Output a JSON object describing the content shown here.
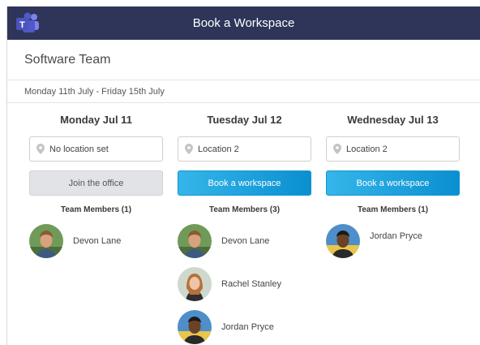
{
  "app": {
    "window_title": "Book a Workspace",
    "logo_icon": "teams-icon"
  },
  "team": {
    "name": "Software Team"
  },
  "date_range": "Monday 11th July - Friday 15th July",
  "colors": {
    "titlebar": "#2e3559",
    "button_blue_start": "#35b6ea",
    "button_blue_end": "#0a8fd0",
    "button_grey": "#e1e3e6"
  },
  "days": [
    {
      "title": "Monday Jul 11",
      "location": "No location set",
      "button": "Join the office",
      "members_label": "Team Members (1)",
      "members": [
        {
          "name": "Devon Lane"
        }
      ]
    },
    {
      "title": "Tuesday Jul 12",
      "location": "Location 2",
      "button": "Book a workspace",
      "members_label": "Team Members (3)",
      "members": [
        {
          "name": "Devon Lane"
        },
        {
          "name": "Rachel Stanley"
        },
        {
          "name": "Jordan Pryce"
        }
      ]
    },
    {
      "title": "Wednesday Jul 13",
      "location": "Location 2",
      "button": "Book a workspace",
      "members_label": "Team Members (1)",
      "members": [
        {
          "name": "Jordan Pryce"
        }
      ]
    }
  ]
}
